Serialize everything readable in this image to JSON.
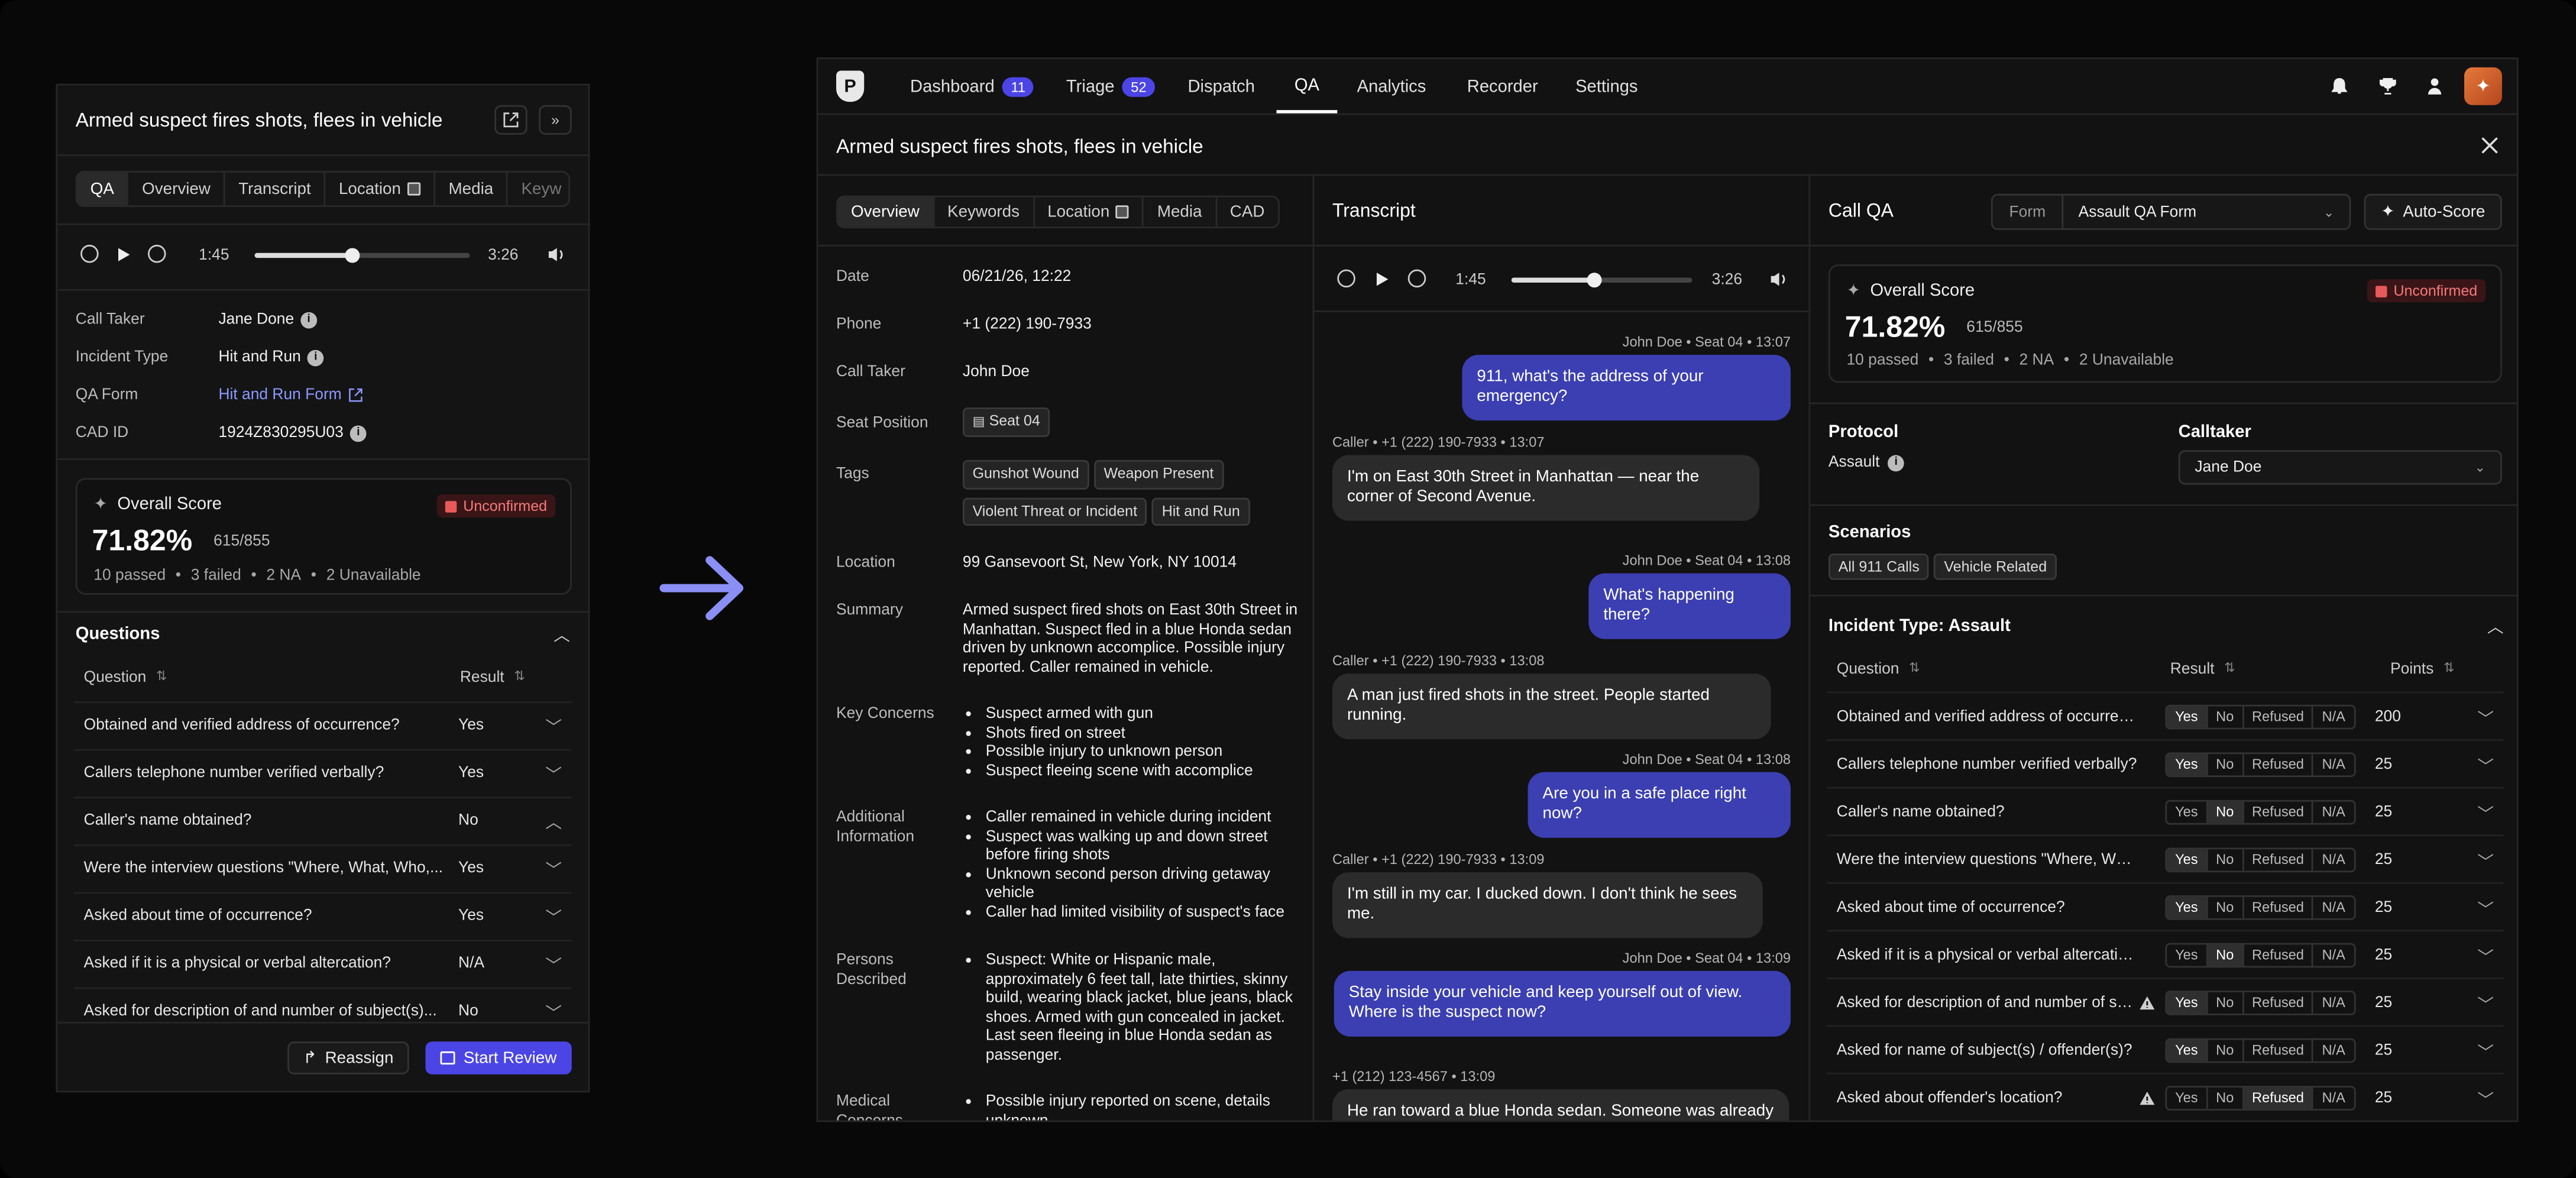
{
  "left": {
    "title": "Armed suspect fires shots, flees in vehicle",
    "tabs": [
      "QA",
      "Overview",
      "Transcript",
      "Location",
      "Media",
      "Keyw"
    ],
    "player": {
      "current": "1:45",
      "total": "3:26",
      "progress": 0.45
    },
    "fields": [
      {
        "label": "Call Taker",
        "value": "Jane Done"
      },
      {
        "label": "Incident Type",
        "value": "Hit and Run"
      },
      {
        "label": "QA Form",
        "value": "Hit and Run Form"
      },
      {
        "label": "CAD ID",
        "value": "1924Z830295U03"
      }
    ],
    "score": {
      "title": "Overall Score",
      "badge": "Unconfirmed",
      "percent": "71.82%",
      "points": "615/855",
      "passed": "10 passed",
      "failed": "3 failed",
      "na": "2 NA",
      "unavailable": "2 Unavailable"
    },
    "questions_title": "Questions",
    "col_question": "Question",
    "col_result": "Result",
    "rows": [
      {
        "q": "Obtained and verified address of occurrence?",
        "r": "Yes"
      },
      {
        "q": "Callers telephone number verified verbally?",
        "r": "Yes"
      },
      {
        "q": "Caller's name obtained?",
        "r": "No"
      },
      {
        "q": "Were the interview questions \"Where, What, Who,...",
        "r": "Yes"
      },
      {
        "q": "Asked about time of occurrence?",
        "r": "Yes"
      },
      {
        "q": "Asked if it is a physical or verbal altercation?",
        "r": "N/A"
      },
      {
        "q": "Asked for description of and number of subject(s)...",
        "r": "No"
      }
    ],
    "reassign": "Reassign",
    "start_review": "Start Review"
  },
  "nav": {
    "items": [
      {
        "label": "Dashboard",
        "count": "11"
      },
      {
        "label": "Triage",
        "count": "52"
      },
      {
        "label": "Dispatch"
      },
      {
        "label": "QA"
      },
      {
        "label": "Analytics"
      },
      {
        "label": "Recorder"
      },
      {
        "label": "Settings"
      }
    ]
  },
  "incident_title": "Armed suspect fires shots, flees in vehicle",
  "overview": {
    "tabs": [
      "Overview",
      "Keywords",
      "Location",
      "Media",
      "CAD"
    ],
    "date_label": "Date",
    "date": "06/21/26, 12:22",
    "phone_label": "Phone",
    "phone": "+1 (222) 190-7933",
    "calltaker_label": "Call Taker",
    "calltaker": "John Doe",
    "seat_label": "Seat Position",
    "seat": "Seat 04",
    "tags_label": "Tags",
    "tags": [
      "Gunshot Wound",
      "Weapon Present",
      "Violent Threat or Incident",
      "Hit and Run"
    ],
    "location_label": "Location",
    "location": "99 Gansevoort St, New York, NY 10014",
    "summary_label": "Summary",
    "summary": "Armed suspect fired shots on East 30th Street in Manhattan. Suspect fled in a blue Honda sedan driven by unknown accomplice. Possible injury reported. Caller remained in vehicle.",
    "concerns_label": "Key Concerns",
    "concerns": [
      "Suspect armed with gun",
      "Shots fired on street",
      "Possible injury to unknown person",
      "Suspect fleeing scene with accomplice"
    ],
    "additional_label": "Additional Information",
    "additional": [
      "Caller remained in vehicle during incident",
      "Suspect was walking up and down street before firing shots",
      "Unknown second person driving getaway vehicle",
      "Caller had limited visibility of suspect's face"
    ],
    "persons_label": "Persons Described",
    "persons": [
      "Suspect: White or Hispanic male, approximately 6 feet tall, late thirties, skinny build, wearing black jacket, blue jeans, black shoes. Armed with gun concealed in jacket. Last seen fleeing in blue Honda sedan as passenger."
    ],
    "medical_label": "Medical Concerns",
    "medical": [
      "Possible injury reported on scene, details unknown"
    ]
  },
  "transcript": {
    "title": "Transcript",
    "player": {
      "current": "1:45",
      "total": "3:26",
      "progress": 0.45
    },
    "messages": [
      {
        "meta": "John Doe • Seat 04 • 13:07",
        "text": "911, what's the address of your emergency?",
        "side": "me"
      },
      {
        "meta": "Caller • +1 (222) 190-7933 • 13:07",
        "text": "I'm on East 30th Street in Manhattan — near the corner of Second Avenue.",
        "side": "th"
      },
      {
        "meta": "John Doe • Seat 04 • 13:08",
        "text": "What's happening there?",
        "side": "me"
      },
      {
        "meta": "Caller • +1 (222) 190-7933 • 13:08",
        "text": "A man just fired shots in the street. People started running.",
        "side": "th"
      },
      {
        "meta": "John Doe • Seat 04 • 13:08",
        "text": "Are you in a safe place right now?",
        "side": "me"
      },
      {
        "meta": "Caller • +1 (222) 190-7933 • 13:09",
        "text": "I'm still in my car. I ducked down. I don't think he sees me.",
        "side": "th"
      },
      {
        "meta": "John Doe • Seat 04 • 13:09",
        "text": "Stay inside your vehicle and keep yourself out of view. Where is the suspect now?",
        "side": "me"
      },
      {
        "meta": "+1 (212) 123-4567 • 13:09",
        "text": "He ran toward a blue Honda sedan. Someone was already in",
        "side": "th"
      }
    ]
  },
  "callqa": {
    "title": "Call QA",
    "form_label": "Form",
    "form_value": "Assault QA Form",
    "autoscore": "Auto-Score",
    "score": {
      "title": "Overall Score",
      "badge": "Unconfirmed",
      "percent": "71.82%",
      "points": "615/855",
      "passed": "10 passed",
      "failed": "3 failed",
      "na": "2 NA",
      "unavailable": "2 Unavailable"
    },
    "protocol_label": "Protocol",
    "protocol": "Assault",
    "calltaker_label": "Calltaker",
    "calltaker": "Jane Doe",
    "scenarios_label": "Scenarios",
    "scenarios": [
      "All 911 Calls",
      "Vehicle Related"
    ],
    "incident_type": "Incident Type: Assault",
    "col_question": "Question",
    "col_result": "Result",
    "col_points": "Points",
    "options": [
      "Yes",
      "No",
      "Refused",
      "N/A"
    ],
    "rows": [
      {
        "q": "Obtained and verified address of occurrence?",
        "sel": "Yes",
        "pts": "200",
        "warn": false
      },
      {
        "q": "Callers telephone number verified verbally?",
        "sel": "Yes",
        "pts": "25",
        "warn": false
      },
      {
        "q": "Caller's name obtained?",
        "sel": "No",
        "pts": "25",
        "warn": false
      },
      {
        "q": "Were the interview questions \"Where, What, Who\"",
        "sel": "Yes",
        "pts": "25",
        "warn": false
      },
      {
        "q": "Asked about time of occurrence?",
        "sel": "Yes",
        "pts": "25",
        "warn": false
      },
      {
        "q": "Asked if it is a physical or verbal altercation?",
        "sel": "No",
        "pts": "25",
        "warn": false
      },
      {
        "q": "Asked for description of and number of subject(s)",
        "sel": "Yes",
        "pts": "25",
        "warn": true
      },
      {
        "q": "Asked for name of subject(s) / offender(s)?",
        "sel": "Yes",
        "pts": "25",
        "warn": false
      },
      {
        "q": "Asked about offender's location?",
        "sel": "Refused",
        "pts": "25",
        "warn": true
      }
    ]
  }
}
